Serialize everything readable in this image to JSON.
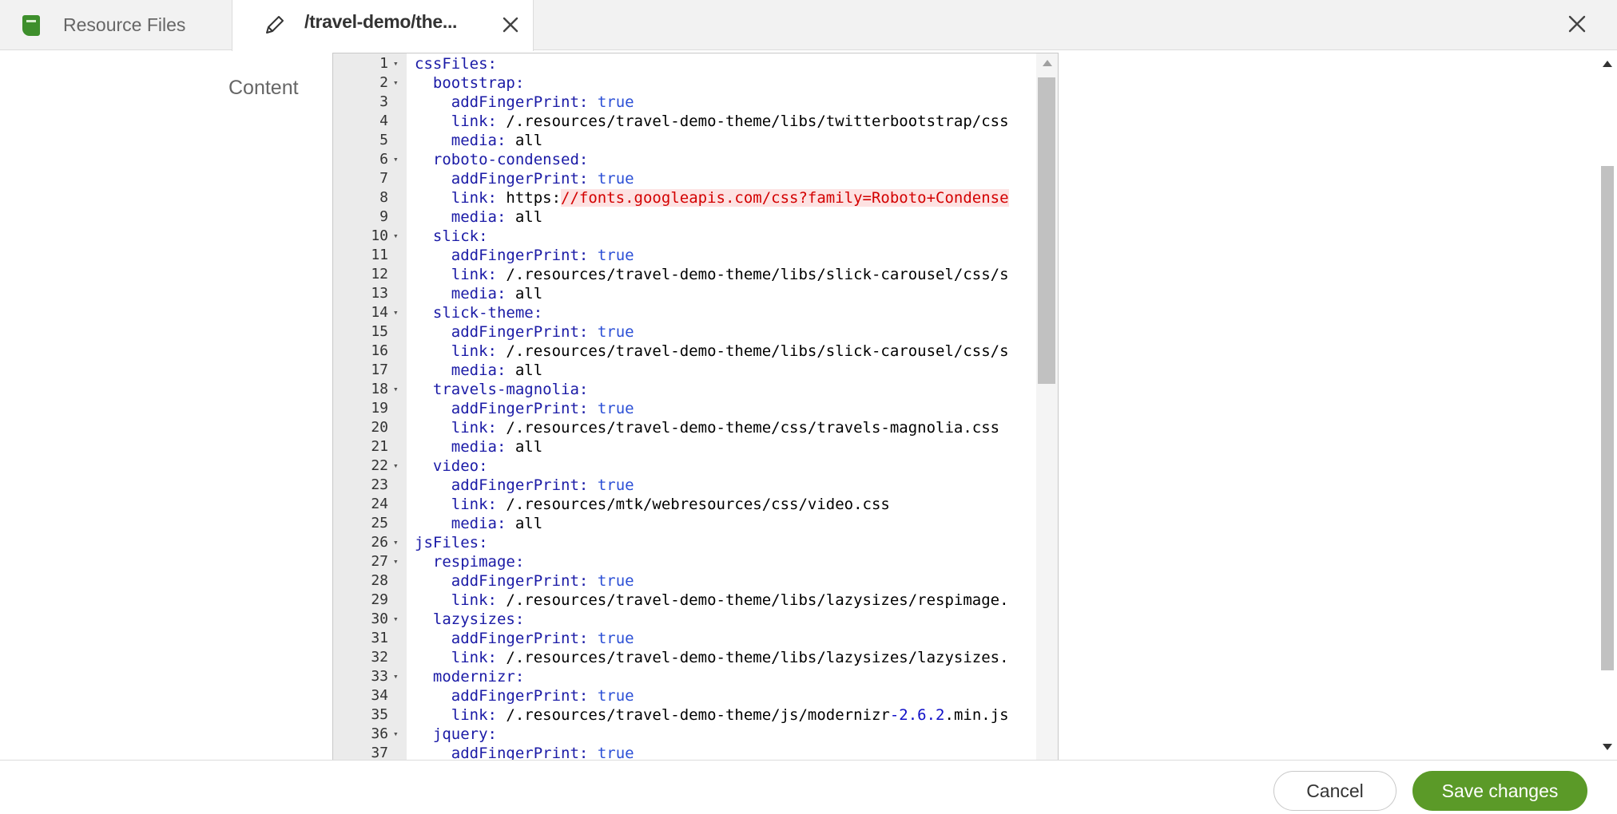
{
  "tabs": {
    "app_label": "Resource Files",
    "active_label": "/travel-demo/the..."
  },
  "form": {
    "field_label": "Content"
  },
  "editor": {
    "lines": [
      {
        "n": "1",
        "fold": true,
        "tokens": [
          {
            "t": "cssFiles:",
            "c": "k"
          }
        ]
      },
      {
        "n": "2",
        "fold": true,
        "tokens": [
          {
            "t": "  "
          },
          {
            "t": "bootstrap:",
            "c": "k"
          }
        ]
      },
      {
        "n": "3",
        "fold": false,
        "tokens": [
          {
            "t": "    "
          },
          {
            "t": "addFingerPrint:",
            "c": "k"
          },
          {
            "t": " "
          },
          {
            "t": "true",
            "c": "b"
          }
        ]
      },
      {
        "n": "4",
        "fold": false,
        "tokens": [
          {
            "t": "    "
          },
          {
            "t": "link:",
            "c": "k"
          },
          {
            "t": " /.resources/travel-demo-theme/libs/twitterbootstrap/css"
          }
        ]
      },
      {
        "n": "5",
        "fold": false,
        "tokens": [
          {
            "t": "    "
          },
          {
            "t": "media:",
            "c": "k"
          },
          {
            "t": " all"
          }
        ]
      },
      {
        "n": "6",
        "fold": true,
        "tokens": [
          {
            "t": "  "
          },
          {
            "t": "roboto-condensed:",
            "c": "k"
          }
        ]
      },
      {
        "n": "7",
        "fold": false,
        "tokens": [
          {
            "t": "    "
          },
          {
            "t": "addFingerPrint:",
            "c": "k"
          },
          {
            "t": " "
          },
          {
            "t": "true",
            "c": "b"
          }
        ]
      },
      {
        "n": "8",
        "fold": false,
        "tokens": [
          {
            "t": "    "
          },
          {
            "t": "link:",
            "c": "k"
          },
          {
            "t": " https:"
          },
          {
            "t": "//fonts.googleapis.com/css?family=Roboto+Condense",
            "c": "u"
          }
        ]
      },
      {
        "n": "9",
        "fold": false,
        "tokens": [
          {
            "t": "    "
          },
          {
            "t": "media:",
            "c": "k"
          },
          {
            "t": " all"
          }
        ]
      },
      {
        "n": "10",
        "fold": true,
        "tokens": [
          {
            "t": "  "
          },
          {
            "t": "slick:",
            "c": "k"
          }
        ]
      },
      {
        "n": "11",
        "fold": false,
        "tokens": [
          {
            "t": "    "
          },
          {
            "t": "addFingerPrint:",
            "c": "k"
          },
          {
            "t": " "
          },
          {
            "t": "true",
            "c": "b"
          }
        ]
      },
      {
        "n": "12",
        "fold": false,
        "tokens": [
          {
            "t": "    "
          },
          {
            "t": "link:",
            "c": "k"
          },
          {
            "t": " /.resources/travel-demo-theme/libs/slick-carousel/css/s"
          }
        ]
      },
      {
        "n": "13",
        "fold": false,
        "tokens": [
          {
            "t": "    "
          },
          {
            "t": "media:",
            "c": "k"
          },
          {
            "t": " all"
          }
        ]
      },
      {
        "n": "14",
        "fold": true,
        "tokens": [
          {
            "t": "  "
          },
          {
            "t": "slick-theme:",
            "c": "k"
          }
        ]
      },
      {
        "n": "15",
        "fold": false,
        "tokens": [
          {
            "t": "    "
          },
          {
            "t": "addFingerPrint:",
            "c": "k"
          },
          {
            "t": " "
          },
          {
            "t": "true",
            "c": "b"
          }
        ]
      },
      {
        "n": "16",
        "fold": false,
        "tokens": [
          {
            "t": "    "
          },
          {
            "t": "link:",
            "c": "k"
          },
          {
            "t": " /.resources/travel-demo-theme/libs/slick-carousel/css/s"
          }
        ]
      },
      {
        "n": "17",
        "fold": false,
        "tokens": [
          {
            "t": "    "
          },
          {
            "t": "media:",
            "c": "k"
          },
          {
            "t": " all"
          }
        ]
      },
      {
        "n": "18",
        "fold": true,
        "tokens": [
          {
            "t": "  "
          },
          {
            "t": "travels-magnolia:",
            "c": "k"
          }
        ]
      },
      {
        "n": "19",
        "fold": false,
        "tokens": [
          {
            "t": "    "
          },
          {
            "t": "addFingerPrint:",
            "c": "k"
          },
          {
            "t": " "
          },
          {
            "t": "true",
            "c": "b"
          }
        ]
      },
      {
        "n": "20",
        "fold": false,
        "tokens": [
          {
            "t": "    "
          },
          {
            "t": "link:",
            "c": "k"
          },
          {
            "t": " /.resources/travel-demo-theme/css/travels-magnolia.css"
          }
        ]
      },
      {
        "n": "21",
        "fold": false,
        "tokens": [
          {
            "t": "    "
          },
          {
            "t": "media:",
            "c": "k"
          },
          {
            "t": " all"
          }
        ]
      },
      {
        "n": "22",
        "fold": true,
        "tokens": [
          {
            "t": "  "
          },
          {
            "t": "video:",
            "c": "k"
          }
        ]
      },
      {
        "n": "23",
        "fold": false,
        "tokens": [
          {
            "t": "    "
          },
          {
            "t": "addFingerPrint:",
            "c": "k"
          },
          {
            "t": " "
          },
          {
            "t": "true",
            "c": "b"
          }
        ]
      },
      {
        "n": "24",
        "fold": false,
        "tokens": [
          {
            "t": "    "
          },
          {
            "t": "link:",
            "c": "k"
          },
          {
            "t": " /.resources/mtk/webresources/css/video.css"
          }
        ]
      },
      {
        "n": "25",
        "fold": false,
        "tokens": [
          {
            "t": "    "
          },
          {
            "t": "media:",
            "c": "k"
          },
          {
            "t": " all"
          }
        ]
      },
      {
        "n": "26",
        "fold": true,
        "tokens": [
          {
            "t": "jsFiles:",
            "c": "k"
          }
        ]
      },
      {
        "n": "27",
        "fold": true,
        "tokens": [
          {
            "t": "  "
          },
          {
            "t": "respimage:",
            "c": "k"
          }
        ]
      },
      {
        "n": "28",
        "fold": false,
        "tokens": [
          {
            "t": "    "
          },
          {
            "t": "addFingerPrint:",
            "c": "k"
          },
          {
            "t": " "
          },
          {
            "t": "true",
            "c": "b"
          }
        ]
      },
      {
        "n": "29",
        "fold": false,
        "tokens": [
          {
            "t": "    "
          },
          {
            "t": "link:",
            "c": "k"
          },
          {
            "t": " /.resources/travel-demo-theme/libs/lazysizes/respimage."
          }
        ]
      },
      {
        "n": "30",
        "fold": true,
        "tokens": [
          {
            "t": "  "
          },
          {
            "t": "lazysizes:",
            "c": "k"
          }
        ]
      },
      {
        "n": "31",
        "fold": false,
        "tokens": [
          {
            "t": "    "
          },
          {
            "t": "addFingerPrint:",
            "c": "k"
          },
          {
            "t": " "
          },
          {
            "t": "true",
            "c": "b"
          }
        ]
      },
      {
        "n": "32",
        "fold": false,
        "tokens": [
          {
            "t": "    "
          },
          {
            "t": "link:",
            "c": "k"
          },
          {
            "t": " /.resources/travel-demo-theme/libs/lazysizes/lazysizes."
          }
        ]
      },
      {
        "n": "33",
        "fold": true,
        "tokens": [
          {
            "t": "  "
          },
          {
            "t": "modernizr:",
            "c": "k"
          }
        ]
      },
      {
        "n": "34",
        "fold": false,
        "tokens": [
          {
            "t": "    "
          },
          {
            "t": "addFingerPrint:",
            "c": "k"
          },
          {
            "t": " "
          },
          {
            "t": "true",
            "c": "b"
          }
        ]
      },
      {
        "n": "35",
        "fold": false,
        "tokens": [
          {
            "t": "    "
          },
          {
            "t": "link:",
            "c": "k"
          },
          {
            "t": " /.resources/travel-demo-theme/js/modernizr"
          },
          {
            "t": "-2.6.2",
            "c": "n"
          },
          {
            "t": ".min.js"
          }
        ]
      },
      {
        "n": "36",
        "fold": true,
        "tokens": [
          {
            "t": "  "
          },
          {
            "t": "jquery:",
            "c": "k"
          }
        ]
      },
      {
        "n": "37",
        "fold": false,
        "tokens": [
          {
            "t": "    "
          },
          {
            "t": "addFingerPrint:",
            "c": "k"
          },
          {
            "t": " "
          },
          {
            "t": "true",
            "c": "b"
          }
        ]
      }
    ]
  },
  "footer": {
    "cancel_label": "Cancel",
    "save_label": "Save changes"
  },
  "colors": {
    "accent_green": "#5b9a28",
    "yaml_key": "#1a1aa6",
    "yaml_bool": "#2b4fd6",
    "url_error": "#d30000"
  },
  "icons": {
    "app": "resource-files-icon",
    "edit": "pencil-icon",
    "close_tab": "close-icon",
    "close_window": "close-icon",
    "fold": "fold-arrow-icon"
  }
}
